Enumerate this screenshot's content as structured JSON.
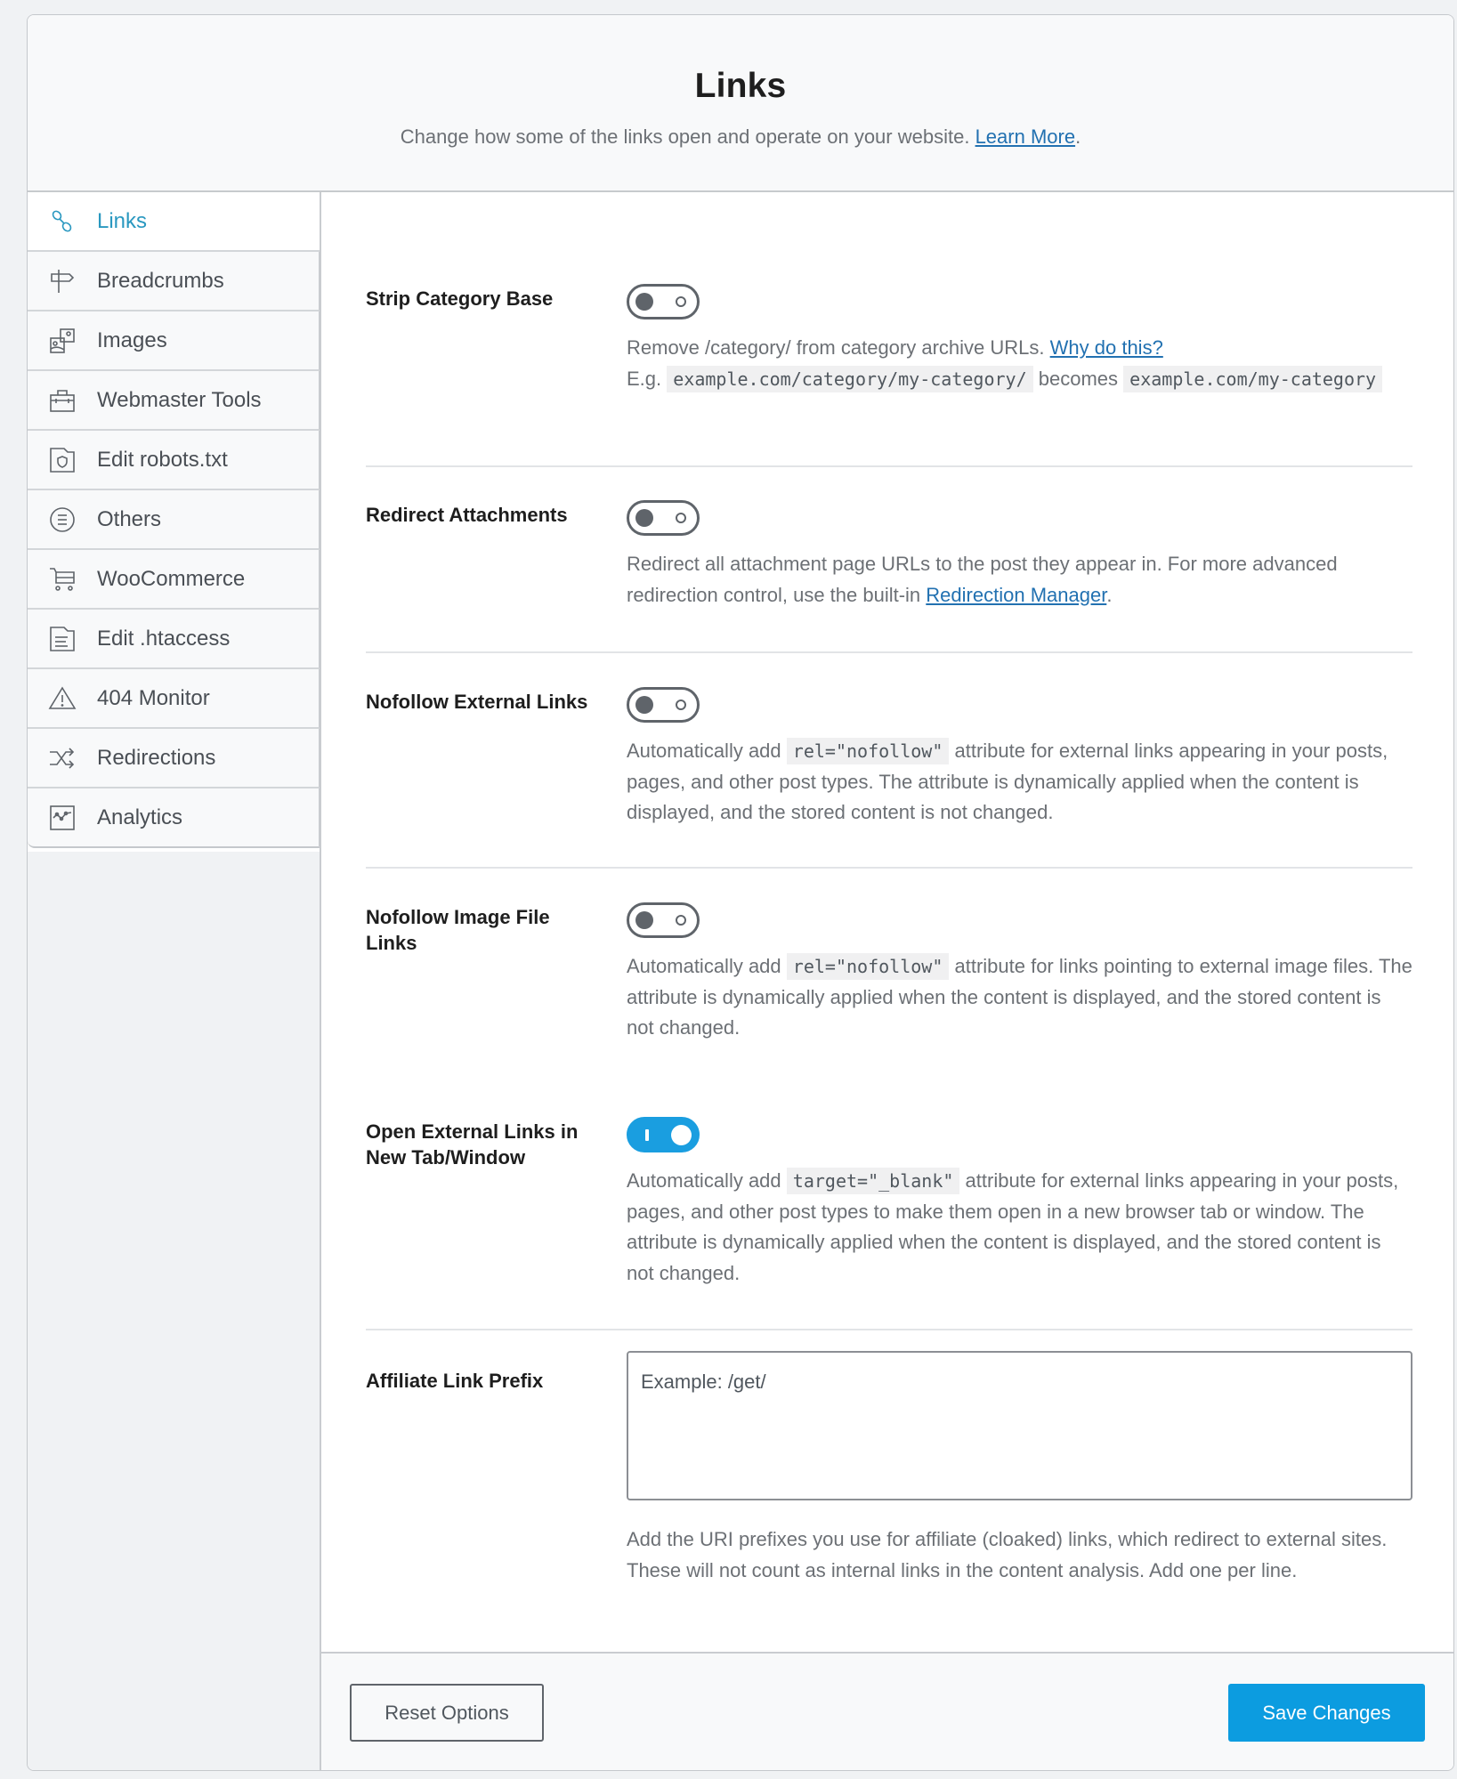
{
  "header": {
    "title": "Links",
    "subtitle": "Change how some of the links open and operate on your website.",
    "learn_more": "Learn More",
    "trailing": "."
  },
  "sidebar": {
    "items": [
      {
        "label": "Links",
        "icon": "link-icon",
        "active": true
      },
      {
        "label": "Breadcrumbs",
        "icon": "signpost-icon"
      },
      {
        "label": "Images",
        "icon": "images-icon"
      },
      {
        "label": "Webmaster Tools",
        "icon": "toolbox-icon"
      },
      {
        "label": "Edit robots.txt",
        "icon": "shield-file-icon"
      },
      {
        "label": "Others",
        "icon": "list-circle-icon"
      },
      {
        "label": "WooCommerce",
        "icon": "cart-icon"
      },
      {
        "label": "Edit .htaccess",
        "icon": "file-text-icon"
      },
      {
        "label": "404 Monitor",
        "icon": "warning-icon"
      },
      {
        "label": "Redirections",
        "icon": "shuffle-icon"
      },
      {
        "label": "Analytics",
        "icon": "chart-icon"
      }
    ]
  },
  "settings": {
    "strip_category": {
      "label": "Strip Category Base",
      "enabled": false,
      "desc_1": "Remove /category/ from category archive URLs.",
      "why_link": "Why do this?",
      "eg": "E.g.",
      "code_1": "example.com/category/my-category/",
      "becomes": "becomes",
      "code_2": "example.com/my-category"
    },
    "redirect_attachments": {
      "label": "Redirect Attachments",
      "enabled": false,
      "desc": "Redirect all attachment page URLs to the post they appear in. For more advanced redirection control, use the built-in",
      "link": "Redirection Manager",
      "trailing": "."
    },
    "nofollow_external": {
      "label": "Nofollow External Links",
      "enabled": false,
      "desc_pre": "Automatically add",
      "code": "rel=\"nofollow\"",
      "desc_post": "attribute for external links appearing in your posts, pages, and other post types. The attribute is dynamically applied when the content is displayed, and the stored content is not changed."
    },
    "nofollow_image": {
      "label": "Nofollow Image File Links",
      "enabled": false,
      "desc_pre": "Automatically add",
      "code": "rel=\"nofollow\"",
      "desc_post": "attribute for links pointing to external image files. The attribute is dynamically applied when the content is displayed, and the stored content is not changed."
    },
    "open_external": {
      "label": "Open External Links in New Tab/Window",
      "enabled": true,
      "desc_pre": "Automatically add",
      "code": "target=\"_blank\"",
      "desc_post": "attribute for external links appearing in your posts, pages, and other post types to make them open in a new browser tab or window. The attribute is dynamically applied when the content is displayed, and the stored content is not changed."
    },
    "affiliate_prefix": {
      "label": "Affiliate Link Prefix",
      "value": "",
      "placeholder": "Example: /get/",
      "desc": "Add the URI prefixes you use for affiliate (cloaked) links, which redirect to external sites. These will not count as internal links in the content analysis. Add one per line."
    }
  },
  "footer": {
    "reset_label": "Reset Options",
    "save_label": "Save Changes"
  },
  "colors": {
    "accent": "#0c9ce0",
    "active_nav": "#2a98c0",
    "link": "#2271b1"
  }
}
